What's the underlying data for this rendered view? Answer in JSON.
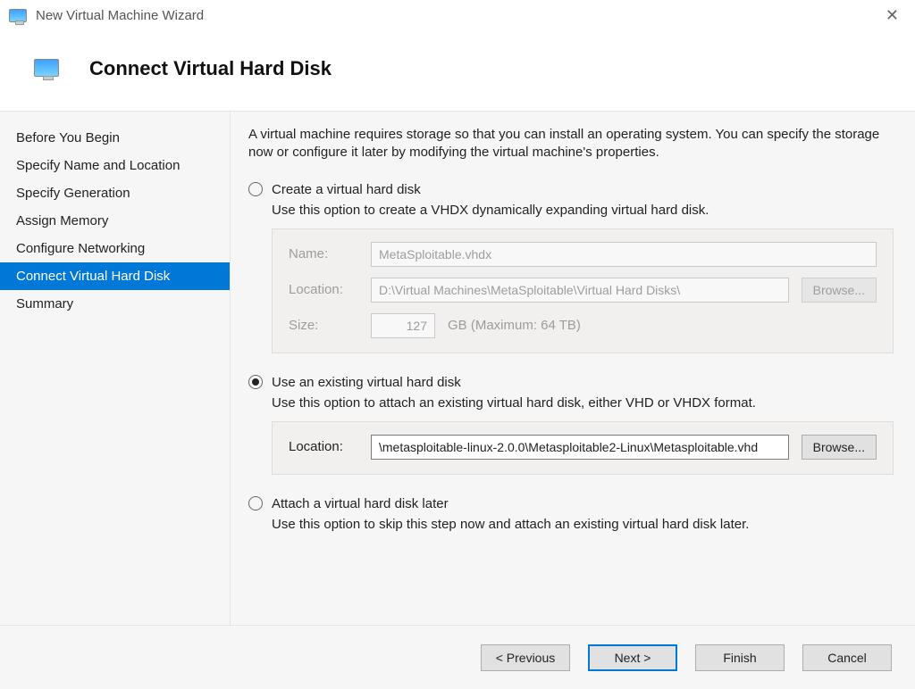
{
  "window": {
    "title": "New Virtual Machine Wizard"
  },
  "header": {
    "title": "Connect Virtual Hard Disk"
  },
  "sidebar": {
    "items": [
      {
        "label": "Before You Begin"
      },
      {
        "label": "Specify Name and Location"
      },
      {
        "label": "Specify Generation"
      },
      {
        "label": "Assign Memory"
      },
      {
        "label": "Configure Networking"
      },
      {
        "label": "Connect Virtual Hard Disk"
      },
      {
        "label": "Summary"
      }
    ],
    "active_index": 5
  },
  "main": {
    "intro": "A virtual machine requires storage so that you can install an operating system. You can specify the storage now or configure it later by modifying the virtual machine's properties.",
    "options": {
      "create": {
        "title": "Create a virtual hard disk",
        "desc": "Use this option to create a VHDX dynamically expanding virtual hard disk.",
        "fields": {
          "name_label": "Name:",
          "name_value": "MetaSploitable.vhdx",
          "location_label": "Location:",
          "location_value": "D:\\Virtual Machines\\MetaSploitable\\Virtual Hard Disks\\",
          "browse_label": "Browse...",
          "size_label": "Size:",
          "size_value": "127",
          "size_suffix": "GB (Maximum: 64 TB)"
        }
      },
      "existing": {
        "title": "Use an existing virtual hard disk",
        "desc": "Use this option to attach an existing virtual hard disk, either VHD or VHDX format.",
        "fields": {
          "location_label": "Location:",
          "location_value": "\\metasploitable-linux-2.0.0\\Metasploitable2-Linux\\Metasploitable.vhd",
          "browse_label": "Browse..."
        }
      },
      "later": {
        "title": "Attach a virtual hard disk later",
        "desc": "Use this option to skip this step now and attach an existing virtual hard disk later."
      },
      "selected": "existing"
    }
  },
  "footer": {
    "previous": "< Previous",
    "next": "Next >",
    "finish": "Finish",
    "cancel": "Cancel"
  }
}
